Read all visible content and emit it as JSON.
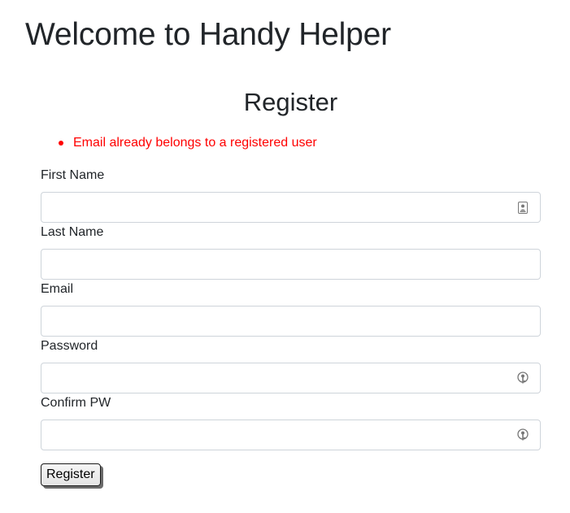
{
  "header": {
    "title": "Welcome to Handy Helper"
  },
  "form": {
    "title": "Register",
    "errors": [
      "Email already belongs to a registered user"
    ],
    "fields": [
      {
        "label": "First Name",
        "value": "",
        "placeholder": "",
        "icon": "contact-card-icon"
      },
      {
        "label": "Last Name",
        "value": "",
        "placeholder": ""
      },
      {
        "label": "Email",
        "value": "",
        "placeholder": ""
      },
      {
        "label": "Password",
        "value": "",
        "placeholder": "",
        "icon": "password-key-icon"
      },
      {
        "label": "Confirm PW",
        "value": "",
        "placeholder": "",
        "icon": "password-key-icon"
      }
    ],
    "submit_label": "Register"
  },
  "colors": {
    "error": "#ff0000",
    "text": "#212529",
    "input_border": "#ced4da"
  }
}
